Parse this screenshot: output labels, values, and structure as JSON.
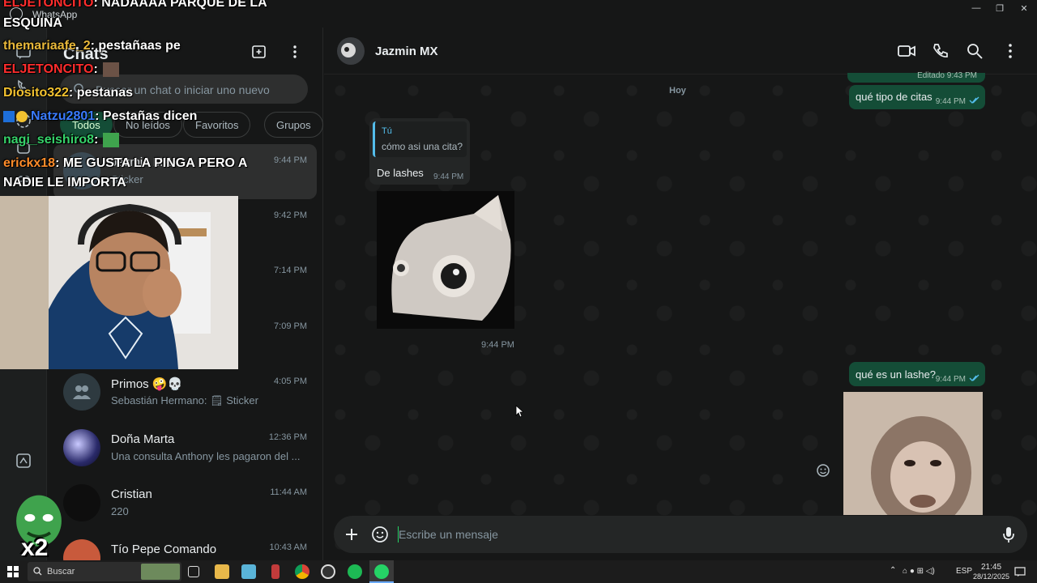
{
  "window": {
    "title": "WhatsApp",
    "controls": [
      "—",
      "❐",
      "✕"
    ]
  },
  "sidebar_list": {
    "title": "Chats",
    "search_placeholder": "Buscar un chat o iniciar uno nuevo",
    "filters": [
      "Todos",
      "No leídos",
      "Favoritos",
      "Grupos"
    ],
    "chats": [
      {
        "name": "Jazmin MX",
        "preview": "Sticker",
        "time": "9:44 PM"
      },
      {
        "name": "",
        "preview": "",
        "time": "9:42 PM"
      },
      {
        "name": "",
        "preview": "",
        "time": "7:14 PM"
      },
      {
        "name": "",
        "preview": "",
        "time": "7:09 PM"
      },
      {
        "name": "Primos 🤪💀",
        "preview": "Sebastián Hermano: 🗒 Sticker",
        "time": "4:05 PM"
      },
      {
        "name": "Doña Marta",
        "preview": "Una consulta Anthony les pagaron del ...",
        "time": "12:36 PM"
      },
      {
        "name": "Cristian",
        "preview": "220",
        "time": "11:44 AM"
      },
      {
        "name": "Tío Pepe Comando",
        "preview": "",
        "time": "10:43 AM"
      }
    ]
  },
  "conversation": {
    "contact_name": "Jazmin MX",
    "day_label": "Hoy",
    "messages": [
      {
        "dir": "out",
        "text": "Editado 9:43 PM",
        "time": ""
      },
      {
        "dir": "out",
        "text": "qué tipo de citas",
        "time": "9:44 PM"
      },
      {
        "dir": "in",
        "quote_author": "Tú",
        "quote_text": "cómo asi una cita?",
        "text": "De lashes",
        "time": "9:44 PM"
      },
      {
        "dir": "in",
        "sticker": "cat-sticker",
        "time": "9:44 PM"
      },
      {
        "dir": "out",
        "text": "qué es un lashe?",
        "time": "9:44 PM"
      },
      {
        "dir": "out",
        "sticker": "monkey-sticker",
        "time": ""
      }
    ],
    "composer_placeholder": "Escribe un mensaje"
  },
  "stream_overlay": {
    "chat": [
      {
        "user": "ELJETONCITO",
        "text": ": NADAAAA PARQUE DE LA",
        "color": "#ff2d2d"
      },
      {
        "user": "",
        "text": "ESQUINA",
        "color": "#ffffff"
      },
      {
        "user": "themariaafe_2",
        "text": ": pestañaas pe",
        "color": "#e8b83a"
      },
      {
        "user": "ELJETONCITO",
        "text": ":",
        "color": "#ff2d2d"
      },
      {
        "user": "Diosito322",
        "text": ": pestanas",
        "color": "#f2c230"
      },
      {
        "user": "Natzu2801",
        "text": ": Pestañas dicen",
        "color": "#3a7bff"
      },
      {
        "user": "nagi_seishiro8",
        "text": ":",
        "color": "#36d36a"
      },
      {
        "user": "erickx18",
        "text": ": ME GUSTA LA PINGA PERO A",
        "color": "#ff8c2a"
      },
      {
        "user": "",
        "text": "NADIE LE IMPORTA",
        "color": "#ffffff"
      }
    ],
    "badge": "x2"
  },
  "taskbar": {
    "search_placeholder": "Buscar",
    "lang": "ESP",
    "time": "21:45",
    "date": "28/12/2025"
  }
}
